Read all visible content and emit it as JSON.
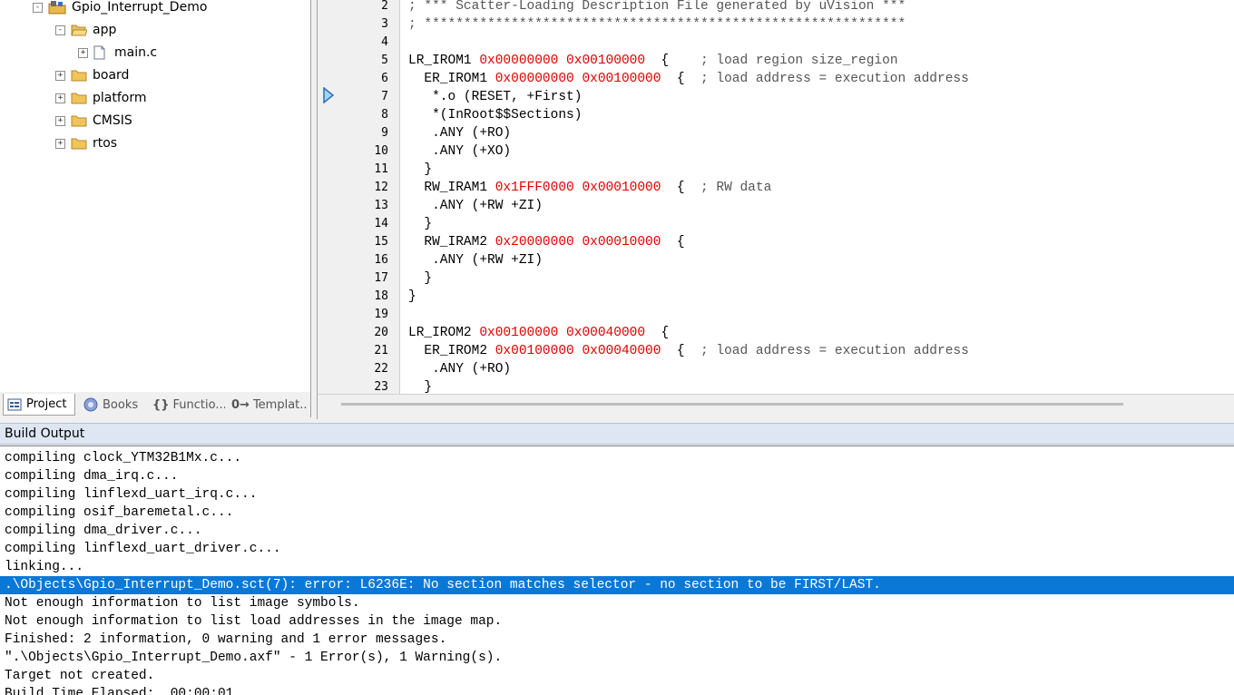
{
  "project_tree": {
    "root": "Gpio_Interrupt_Demo",
    "items": [
      {
        "label": "app",
        "expander": "-",
        "kind": "folder-open"
      },
      {
        "label": "main.c",
        "expander": "+",
        "kind": "file"
      },
      {
        "label": "board",
        "expander": "+",
        "kind": "folder"
      },
      {
        "label": "platform",
        "expander": "+",
        "kind": "folder"
      },
      {
        "label": "CMSIS",
        "expander": "+",
        "kind": "folder"
      },
      {
        "label": "rtos",
        "expander": "+",
        "kind": "folder"
      }
    ],
    "root_expander": "-"
  },
  "panel_tabs": [
    {
      "label": "Project",
      "icon": "project-icon"
    },
    {
      "label": "Books",
      "icon": "books-icon"
    },
    {
      "label": "Functio...",
      "icon": "functions-icon",
      "glyph": "{}"
    },
    {
      "label": "Templat...",
      "icon": "templates-icon",
      "glyph": "0→"
    }
  ],
  "editor": {
    "lines": [
      {
        "n": "2",
        "text": "; *** Scatter-Loading Description File generated by uVision ***"
      },
      {
        "n": "3",
        "text": "; *************************************************************"
      },
      {
        "n": "4",
        "text": ""
      },
      {
        "n": "5",
        "text": "LR_IROM1 0x00000000 0x00100000  {    ; load region size_region"
      },
      {
        "n": "6",
        "text": "  ER_IROM1 0x00000000 0x00100000  {  ; load address = execution address"
      },
      {
        "n": "7",
        "text": "   *.o (RESET, +First)"
      },
      {
        "n": "8",
        "text": "   *(InRoot$$Sections)"
      },
      {
        "n": "9",
        "text": "   .ANY (+RO)"
      },
      {
        "n": "10",
        "text": "   .ANY (+XO)"
      },
      {
        "n": "11",
        "text": "  }"
      },
      {
        "n": "12",
        "text": "  RW_IRAM1 0x1FFF0000 0x00010000  {  ; RW data"
      },
      {
        "n": "13",
        "text": "   .ANY (+RW +ZI)"
      },
      {
        "n": "14",
        "text": "  }"
      },
      {
        "n": "15",
        "text": "  RW_IRAM2 0x20000000 0x00010000  {"
      },
      {
        "n": "16",
        "text": "   .ANY (+RW +ZI)"
      },
      {
        "n": "17",
        "text": "  }"
      },
      {
        "n": "18",
        "text": "}"
      },
      {
        "n": "19",
        "text": ""
      },
      {
        "n": "20",
        "text": "LR_IROM2 0x00100000 0x00040000  {"
      },
      {
        "n": "21",
        "text": "  ER_IROM2 0x00100000 0x00040000  {  ; load address = execution address"
      },
      {
        "n": "22",
        "text": "   .ANY (+RO)"
      },
      {
        "n": "23",
        "text": "  }"
      }
    ]
  },
  "build_output": {
    "title": "Build Output",
    "selected_index": 7,
    "lines": [
      "compiling clock_YTM32B1Mx.c...",
      "compiling dma_irq.c...",
      "compiling linflexd_uart_irq.c...",
      "compiling osif_baremetal.c...",
      "compiling dma_driver.c...",
      "compiling linflexd_uart_driver.c...",
      "linking...",
      ".\\Objects\\Gpio_Interrupt_Demo.sct(7): error: L6236E: No section matches selector - no section to be FIRST/LAST.",
      "Not enough information to list image symbols.",
      "Not enough information to list load addresses in the image map.",
      "Finished: 2 information, 0 warning and 1 error messages.",
      "\".\\Objects\\Gpio_Interrupt_Demo.axf\" - 1 Error(s), 1 Warning(s).",
      "Target not created.",
      "Build Time Elapsed:  00:00:01"
    ]
  },
  "colors": {
    "selection": "#0a78d7",
    "hex_literal": "#e00000",
    "comment": "#555555",
    "build_header_bg": "#dde6f2"
  }
}
